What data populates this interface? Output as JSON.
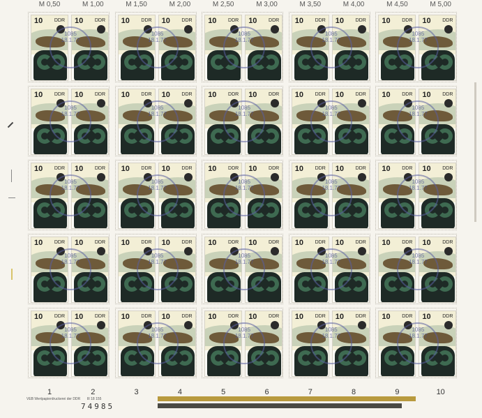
{
  "sheet": {
    "top_values": [
      "M 0,50",
      "M 1,00",
      "M 1,50",
      "M 2,00",
      "M 2,50",
      "M 3,00",
      "M 3,50",
      "M 4,00",
      "M 4,50",
      "M 5,00"
    ],
    "stamp": {
      "denomination": "10",
      "country": "DDR"
    },
    "cancel_text": "1085\n18.1.77",
    "bottom_numbers": [
      "1",
      "2",
      "3",
      "4",
      "5",
      "6",
      "7",
      "8",
      "9",
      "10"
    ],
    "printer_text": "VEB Wertpapierdruckerei der DDR",
    "printer_code": "III 18 155",
    "serial": "74985",
    "color_bar_colors": [
      "#b89a3e",
      "#4a4a44"
    ],
    "margin_accent_color": "#d8c46a"
  }
}
